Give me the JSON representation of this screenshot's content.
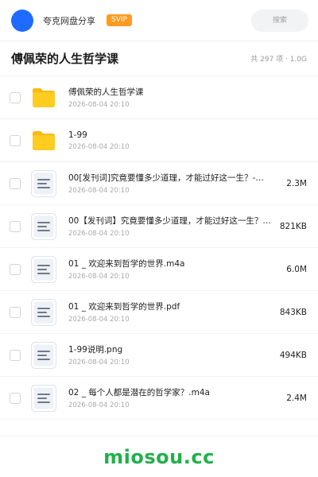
{
  "header": {
    "app_name": "夸克网盘分享",
    "badge": "SVIP",
    "search_placeholder": "搜索",
    "avatar_color": "#1f6bff",
    "badge_color": "#ff9a1f"
  },
  "titlebar": {
    "title": "傅佩荣的人生哲学课",
    "summary": "共 297 项 · 1.0G"
  },
  "files": [
    {
      "type": "folder",
      "icon": "folder-icon",
      "name": "傅佩荣的人生哲学课",
      "date": "2026-08-04 20:10",
      "size": ""
    },
    {
      "type": "folder",
      "icon": "folder-icon",
      "name": "1-99",
      "date": "2026-08-04 20:10",
      "size": ""
    },
    {
      "type": "file",
      "icon": "document-icon",
      "name": "00[发刊词]究竟要懂多少道理，才能过好这一生？-…",
      "date": "2026-08-04 20:10",
      "size": "2.3M"
    },
    {
      "type": "file",
      "icon": "document-icon",
      "name": "00【发刊词】究竟要懂多少道理，才能过好这一生？.…",
      "date": "2026-08-04 20:10",
      "size": "821KB"
    },
    {
      "type": "file",
      "icon": "document-icon",
      "name": "01 _ 欢迎来到哲学的世界.m4a",
      "date": "2026-08-04 20:10",
      "size": "6.0M"
    },
    {
      "type": "file",
      "icon": "document-icon",
      "name": "01 _ 欢迎来到哲学的世界.pdf",
      "date": "2026-08-04 20:10",
      "size": "843KB"
    },
    {
      "type": "file",
      "icon": "document-icon",
      "name": "1-99说明.png",
      "date": "2026-08-04 20:10",
      "size": "494KB"
    },
    {
      "type": "file",
      "icon": "document-icon",
      "name": "02 _ 每个人都是潜在的哲学家？.m4a",
      "date": "2026-08-04 20:10",
      "size": "2.4M"
    }
  ],
  "footer": {
    "watermark": "miosou.cc",
    "watermark_color": "#21b04b"
  }
}
